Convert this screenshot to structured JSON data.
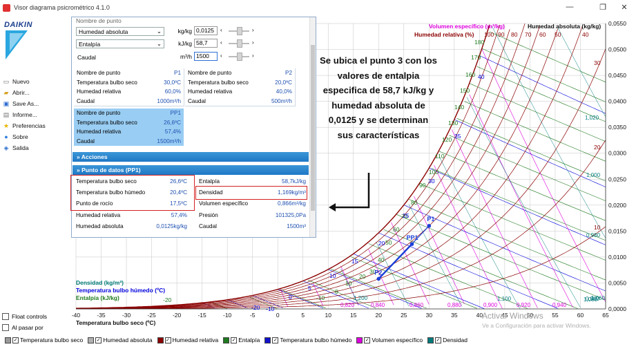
{
  "window": {
    "title": "Visor diagrama psicrométrico 4.1.0",
    "minimize": "—",
    "restore": "❐",
    "close": "✕"
  },
  "brand": "DAIKIN",
  "menu": [
    {
      "label": "Nuevo",
      "icon": "new-file-icon",
      "glyph": "▭"
    },
    {
      "label": "Abrir...",
      "icon": "open-folder-icon",
      "glyph": "▰"
    },
    {
      "label": "Save As...",
      "icon": "save-icon",
      "glyph": "▣"
    },
    {
      "label": "Informe...",
      "icon": "report-icon",
      "glyph": "▤"
    },
    {
      "label": "Preferencias",
      "icon": "star-icon",
      "glyph": "★"
    },
    {
      "label": "Sobre",
      "icon": "info-icon",
      "glyph": "●"
    },
    {
      "label": "Salida",
      "icon": "exit-icon",
      "glyph": "◈"
    }
  ],
  "options": {
    "float_controls": "Float controls",
    "on_hover": "Al pasar por"
  },
  "inputs": {
    "partial_label": "Nombre de punto",
    "row1": {
      "select": "Humedad absoluta",
      "unit": "kg/kg",
      "value": "0,0125"
    },
    "row2": {
      "select": "Entalpía",
      "unit": "kJ/kg",
      "value": "58,7"
    },
    "row3": {
      "label": "Caudal",
      "unit": "m³/h",
      "value": "1500"
    }
  },
  "points": [
    {
      "rows": [
        [
          "Nombre de punto",
          "P1"
        ],
        [
          "Temperatura bulbo seco",
          "30,0ºC"
        ],
        [
          "Humedad relativa",
          "60,0%"
        ],
        [
          "Caudal",
          "1000m³/h"
        ]
      ]
    },
    {
      "rows": [
        [
          "Nombre de punto",
          "P2"
        ],
        [
          "Temperatura bulbo seco",
          "20,0ºC"
        ],
        [
          "Humedad relativa",
          "40,0%"
        ],
        [
          "Caudal",
          "500m³/h"
        ]
      ]
    },
    {
      "rows": [
        [
          "Nombre de punto",
          "PP1"
        ],
        [
          "Temperatura bulbo seco",
          "26,6ºC"
        ],
        [
          "Humedad relativa",
          "57,4%"
        ],
        [
          "Caudal",
          "1500m³/h"
        ]
      ]
    }
  ],
  "sections": {
    "actions": "»  Acciones",
    "data": "»  Punto de datos (PP1)"
  },
  "results": [
    [
      "Temperatura bulbo seco",
      "26,6ºC",
      "Entalpía",
      "58,7kJ/kg"
    ],
    [
      "Temperatura bulbo húmedo",
      "20,4ºC",
      "Densidad",
      "1,169kg/m³"
    ],
    [
      "Punto de rocío",
      "17,5ºC",
      "Volumen específico",
      "0,866m³/kg"
    ],
    [
      "Humedad relativa",
      "57,4%",
      "Presión",
      "101325,0Pa"
    ],
    [
      "Humedad absoluta",
      "0,0125kg/kg",
      "Caudal",
      "1500m³"
    ]
  ],
  "annotation": "Se ubica el punto 3 con los valores de entalpia especifica de 58,7 kJ/kg  y humedad absoluta de 0,0125 y se determinan sus características",
  "chart_data": {
    "type": "psychrometric",
    "xlabel": "Temperatura bulbo seco (ºC)",
    "y2label": "Humedad absoluta (kg/kg)",
    "x_ticks": [
      "-40",
      "-35",
      "-30",
      "-25",
      "-20",
      "-15",
      "-10",
      "-5",
      "0",
      "5",
      "10",
      "15",
      "20",
      "25",
      "30",
      "35",
      "40",
      "45",
      "50",
      "55",
      "60",
      "65"
    ],
    "xlim": [
      -40,
      65
    ],
    "y_ticks": [
      "0,0000",
      "0,0050",
      "0,0100",
      "0,0150",
      "0,0200",
      "0,0250",
      "0,0300",
      "0,0350",
      "0,0400",
      "0,0450",
      "0,0500",
      "0,0550"
    ],
    "ylim": [
      0,
      0.055
    ],
    "header_volume": "Volumen específico (m³/kg)",
    "header_rh": "Humedad relativa (%)",
    "rh_ticks": [
      "100",
      "90",
      "80",
      "70",
      "60",
      "50",
      "40"
    ],
    "enthalpy_labels": [
      "180",
      "170",
      "160",
      "150",
      "140",
      "130",
      "120",
      "110",
      "100",
      "90",
      "80",
      "70",
      "60",
      "50",
      "40",
      "30",
      "20",
      "10",
      "0",
      "-10",
      "-20"
    ],
    "wetbulb_labels": [
      "40",
      "35",
      "30",
      "25",
      "20",
      "15",
      "10",
      "5",
      "0",
      "-10",
      "-20"
    ],
    "rh_right_labels": [
      "30",
      "20",
      "10"
    ],
    "density_labels": [
      "1,020",
      "1,000",
      "0,980",
      "0,960",
      "1,060",
      "1,080",
      "1,100",
      "1,200"
    ],
    "volume_labels": [
      "0,820",
      "0,840",
      "0,860",
      "0,880",
      "0,900",
      "0,920",
      "0,940"
    ],
    "left_legend": [
      "Densidad (kg/m³)",
      "Temperatura bulbo húmedo (ºC)",
      "Entalpía (kJ/kg)"
    ],
    "points": [
      {
        "name": "P1",
        "t": 30.0,
        "w": 0.016
      },
      {
        "name": "P2",
        "t": 20.0,
        "w": 0.0058
      },
      {
        "name": "PP1",
        "t": 26.6,
        "w": 0.0125
      }
    ],
    "colors": {
      "rh": "#8b0000",
      "enthalpy": "#1f7a1f",
      "wetbulb": "#0000dd",
      "volume": "#dd00dd",
      "density": "#007a7a",
      "grid": "#bbbbbb",
      "point": "#1a3fd6"
    }
  },
  "legend": [
    {
      "label": "Temperatura bulbo seco",
      "color": "#9a9a9a"
    },
    {
      "label": "Humedad absoluta",
      "color": "#b0b0b0"
    },
    {
      "label": "Humedad relativa",
      "color": "#8b0000"
    },
    {
      "label": "Entalpía",
      "color": "#1f7a1f"
    },
    {
      "label": "Temperatura bulbo húmedo",
      "color": "#1111cc"
    },
    {
      "label": "Volumen específico",
      "color": "#dd00dd"
    },
    {
      "label": "Densidad",
      "color": "#007a7a"
    }
  ],
  "watermark": {
    "title": "Activar Windows",
    "subtitle": "Ve a Configuración para activar Windows."
  }
}
